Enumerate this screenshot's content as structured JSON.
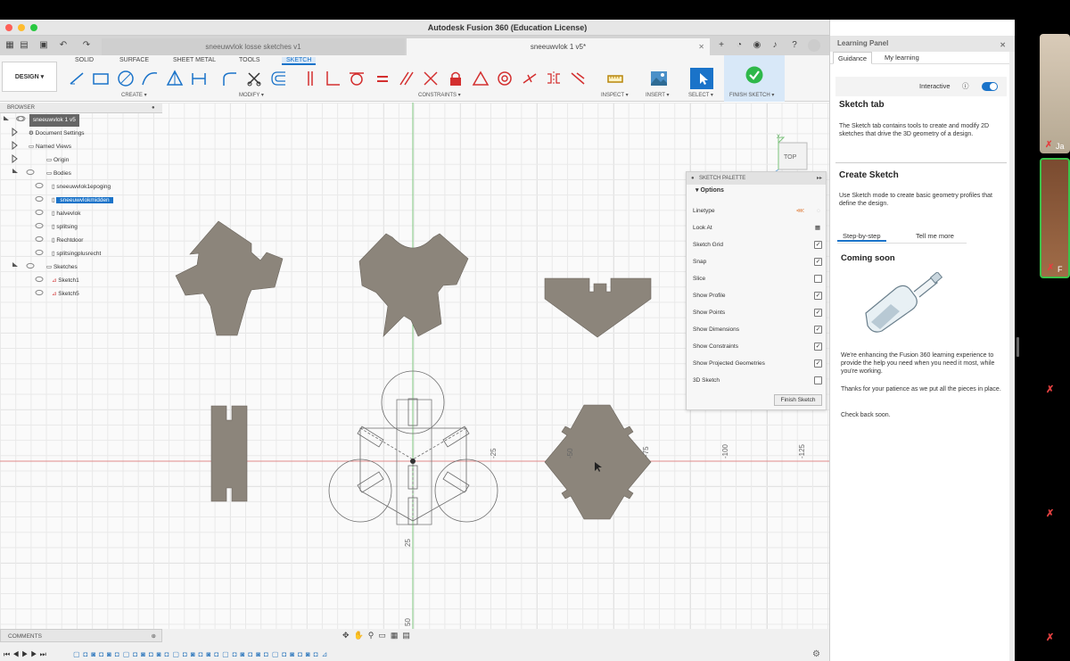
{
  "window": {
    "title": "Autodesk Fusion 360 (Education License)"
  },
  "doc_tabs": [
    {
      "label": "sneeuwvlok losse sketches v1",
      "active": false
    },
    {
      "label": "sneeuwvlok 1 v5*",
      "active": true
    }
  ],
  "ribbon": {
    "workspace": "DESIGN",
    "tabs": [
      "SOLID",
      "SURFACE",
      "SHEET METAL",
      "TOOLS",
      "SKETCH"
    ],
    "selected_tab": "SKETCH",
    "groups": [
      "CREATE",
      "MODIFY",
      "CONSTRAINTS",
      "INSPECT",
      "INSERT",
      "SELECT",
      "FINISH SKETCH"
    ]
  },
  "browser": {
    "header": "BROWSER",
    "root": "sneeuwvlok 1 v5",
    "items": [
      "Document Settings",
      "Named Views",
      "Origin",
      "Bodies",
      "sneeuwvlok1epoging",
      "sneeuwvlokmidden",
      "halvevlok",
      "splitsing",
      "Rechtdoor",
      "splitsingplusrecht",
      "Sketches",
      "Sketch1",
      "Sketch5"
    ],
    "selected": "sneeuwvlokmidden"
  },
  "viewcube": {
    "face": "TOP",
    "axis_x": "X",
    "axis_z": "Z"
  },
  "palette": {
    "title": "SKETCH PALETTE",
    "section": "Options",
    "options": [
      {
        "label": "Linetype"
      },
      {
        "label": "Look At"
      },
      {
        "label": "Sketch Grid",
        "checked": true
      },
      {
        "label": "Snap",
        "checked": true
      },
      {
        "label": "Slice",
        "checked": false
      },
      {
        "label": "Show Profile",
        "checked": true
      },
      {
        "label": "Show Points",
        "checked": true
      },
      {
        "label": "Show Dimensions",
        "checked": true
      },
      {
        "label": "Show Constraints",
        "checked": true
      },
      {
        "label": "Show Projected Geometries",
        "checked": true
      },
      {
        "label": "3D Sketch",
        "checked": false
      }
    ],
    "finish_button": "Finish Sketch"
  },
  "axis_labels": {
    "h1": "25",
    "h2": "50",
    "v1": "-25",
    "v2": "-50",
    "v3": "-75",
    "v4": "-100",
    "v5": "-125"
  },
  "comments": "COMMENTS",
  "learning_panel": {
    "title": "Learning Panel",
    "tabs": [
      "Guidance",
      "My learning"
    ],
    "interactive_label": "Interactive",
    "interactive_on": true,
    "sections": [
      {
        "heading": "Sketch tab",
        "body": "The Sketch tab contains tools to create and modify 2D sketches that drive the 3D geometry of a design."
      },
      {
        "heading": "Create Sketch",
        "body": "Use Sketch mode to create basic geometry profiles that define the design."
      }
    ],
    "sub_tabs": [
      "Step-by-step",
      "Tell me more"
    ],
    "coming_soon": "Coming soon",
    "body1": "We're enhancing the Fusion 360 learning experience to provide the help you need when you need it most, while you're working.",
    "body2": "Thanks for your patience as we put all the pieces in place.",
    "body3": "Check back soon."
  },
  "video_strip": {
    "label_1": "Ja",
    "label_2": "F"
  },
  "colors": {
    "accent": "#1a73c9",
    "body_fill": "#8c857b",
    "grid_minor": "#e9e9e9",
    "grid_major": "#dcdcdc"
  }
}
